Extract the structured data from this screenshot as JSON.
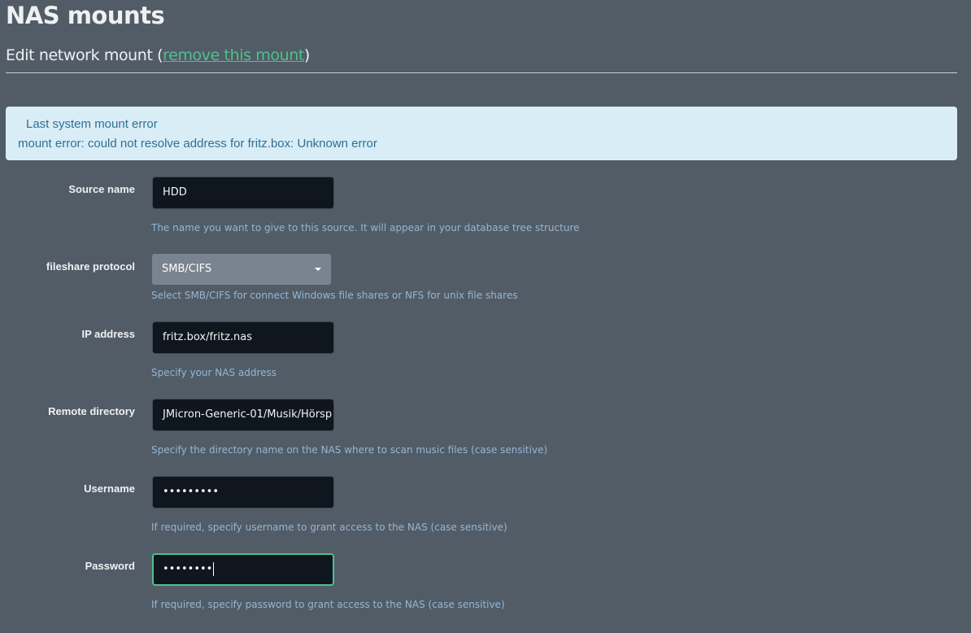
{
  "page": {
    "title": "NAS mounts"
  },
  "section": {
    "title_prefix": "Edit network mount (",
    "remove_link": "remove this mount",
    "title_suffix": ")"
  },
  "alert": {
    "title": "Last system mount error",
    "message": "mount error: could not resolve address for fritz.box: Unknown error",
    "background_color": "#d9edf7",
    "text_color": "#31708f"
  },
  "form": {
    "source_name": {
      "label": "Source name",
      "value": "HDD",
      "help": "The name you want to give to this source. It will appear in your database tree structure"
    },
    "protocol": {
      "label": "fileshare protocol",
      "selected": "SMB/CIFS",
      "help": "Select SMB/CIFS for connect Windows file shares or NFS for unix file shares"
    },
    "ip_address": {
      "label": "IP address",
      "value": "fritz.box/fritz.nas",
      "help": "Specify your NAS address"
    },
    "remote_directory": {
      "label": "Remote directory",
      "value": "JMicron-Generic-01/Musik/Hörsp",
      "help": "Specify the directory name on the NAS where to scan music files (case sensitive)"
    },
    "username": {
      "label": "Username",
      "value_masked": "•••••••••",
      "help": "If required, specify username to grant access to the NAS (case sensitive)"
    },
    "password": {
      "label": "Password",
      "value_masked": "••••••••",
      "help": "If required, specify password to grant access to the NAS (case sensitive)",
      "focused": true
    }
  },
  "colors": {
    "page_background": "#525c66",
    "accent_green": "#4fc08d",
    "input_background": "#0f161e",
    "help_text": "#94b6d4"
  },
  "icons": {
    "select_caret": "caret-down-icon"
  }
}
